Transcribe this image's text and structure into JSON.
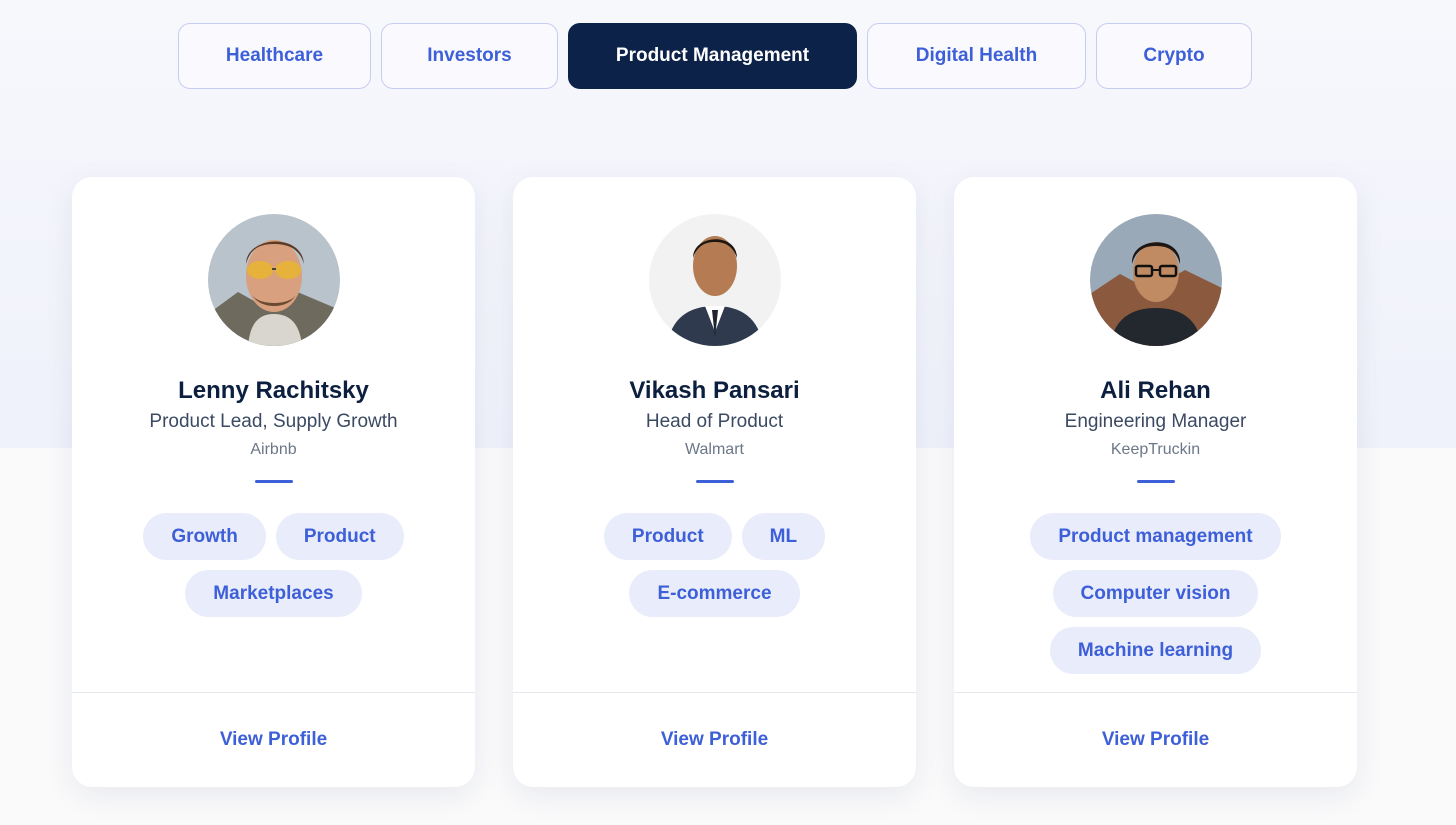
{
  "colors": {
    "accent": "#3d5fd8",
    "active_tab_bg": "#0c2249",
    "tag_bg": "#e9ecfb"
  },
  "tabs": [
    {
      "label": "Healthcare",
      "active": false
    },
    {
      "label": "Investors",
      "active": false
    },
    {
      "label": "Product Management",
      "active": true
    },
    {
      "label": "Digital Health",
      "active": false
    },
    {
      "label": "Crypto",
      "active": false
    }
  ],
  "mentors": [
    {
      "name": "Lenny Rachitsky",
      "role": "Product Lead, Supply Growth",
      "company": "Airbnb",
      "tags": [
        "Growth",
        "Product",
        "Marketplaces"
      ],
      "cta": "View Profile"
    },
    {
      "name": "Vikash Pansari",
      "role": "Head of Product",
      "company": "Walmart",
      "tags": [
        "Product",
        "ML",
        "E-commerce"
      ],
      "cta": "View Profile"
    },
    {
      "name": "Ali Rehan",
      "role": "Engineering Manager",
      "company": "KeepTruckin",
      "tags": [
        "Product management",
        "Computer vision",
        "Machine learning"
      ],
      "cta": "View Profile"
    }
  ]
}
